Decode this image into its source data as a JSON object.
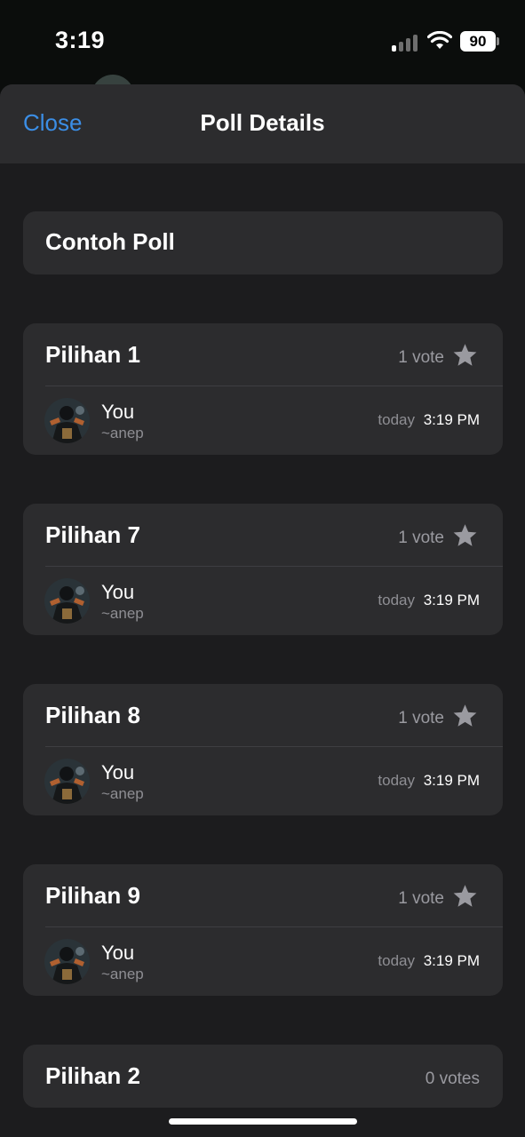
{
  "status_bar": {
    "time": "3:19",
    "battery": "90",
    "icons": [
      "cellular-signal-icon",
      "wifi-icon",
      "battery-icon"
    ]
  },
  "header": {
    "close_label": "Close",
    "title": "Poll Details"
  },
  "poll": {
    "question": "Contoh Poll"
  },
  "options": [
    {
      "label": "Pilihan 1",
      "votes": "1 vote",
      "starred": true,
      "voters": [
        {
          "name": "You",
          "handle": "~anep",
          "day": "today",
          "time": "3:19 PM"
        }
      ]
    },
    {
      "label": "Pilihan 7",
      "votes": "1 vote",
      "starred": true,
      "voters": [
        {
          "name": "You",
          "handle": "~anep",
          "day": "today",
          "time": "3:19 PM"
        }
      ]
    },
    {
      "label": "Pilihan 8",
      "votes": "1 vote",
      "starred": true,
      "voters": [
        {
          "name": "You",
          "handle": "~anep",
          "day": "today",
          "time": "3:19 PM"
        }
      ]
    },
    {
      "label": "Pilihan 9",
      "votes": "1 vote",
      "starred": true,
      "voters": [
        {
          "name": "You",
          "handle": "~anep",
          "day": "today",
          "time": "3:19 PM"
        }
      ]
    },
    {
      "label": "Pilihan 2",
      "votes": "0 votes",
      "starred": false,
      "voters": []
    }
  ],
  "colors": {
    "accent": "#3b8ee6",
    "sheet_bg": "#1c1c1e",
    "card_bg": "#2c2c2e",
    "secondary_text": "#8e8e93"
  }
}
